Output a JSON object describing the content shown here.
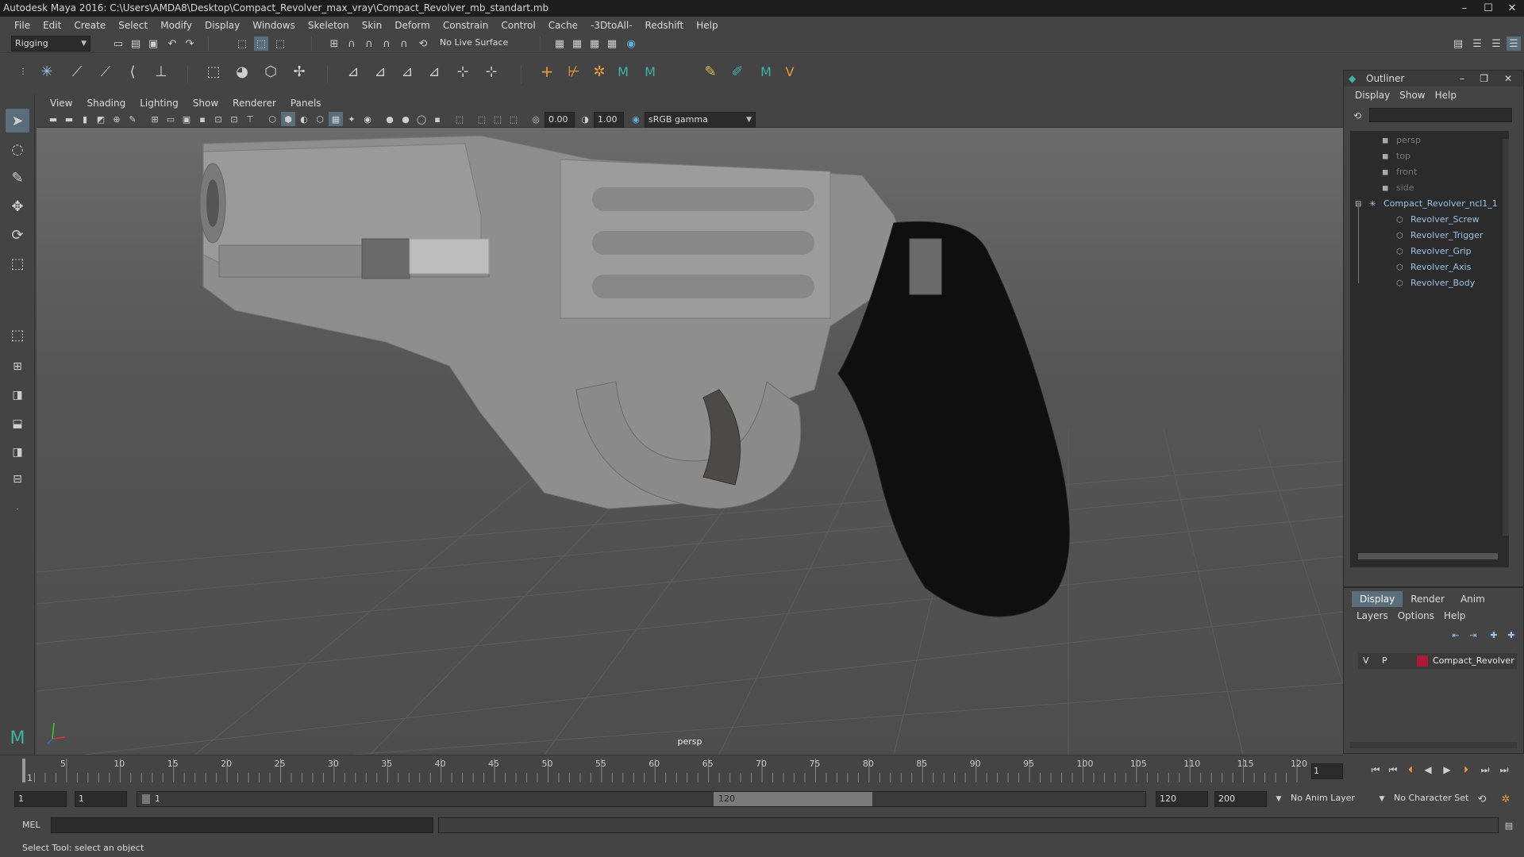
{
  "title": "Autodesk Maya 2016: C:\\Users\\AMDA8\\Desktop\\Compact_Revolver_max_vray\\Compact_Revolver_mb_standart.mb",
  "menu": [
    "File",
    "Edit",
    "Create",
    "Select",
    "Modify",
    "Display",
    "Windows",
    "Skeleton",
    "Skin",
    "Deform",
    "Constrain",
    "Control",
    "Cache",
    "-3DtoAll-",
    "Redshift",
    "Help"
  ],
  "shelf": {
    "mode": "Rigging",
    "live_surface": "No Live Surface"
  },
  "viewport": {
    "menu": [
      "View",
      "Shading",
      "Lighting",
      "Show",
      "Renderer",
      "Panels"
    ],
    "exposure": "0.00",
    "gamma": "1.00",
    "color_space": "sRGB gamma",
    "camera_label": "persp"
  },
  "timeline": {
    "ticks": [
      "1",
      "5",
      "10",
      "15",
      "20",
      "25",
      "30",
      "35",
      "40",
      "45",
      "50",
      "55",
      "60",
      "65",
      "70",
      "75",
      "80",
      "85",
      "90",
      "95",
      "100",
      "105",
      "110",
      "115",
      "120"
    ],
    "current_frame": "1"
  },
  "range": {
    "start": "1",
    "inner_start": "1",
    "slider_start": "1",
    "slider_end": "120",
    "end": "120",
    "anim_end": "200",
    "anim_layer": "No Anim Layer",
    "character_set": "No Character Set"
  },
  "mel": {
    "label": "MEL"
  },
  "help_line": "Select Tool: select an object",
  "outliner": {
    "title": "Outliner",
    "menu": [
      "Display",
      "Show",
      "Help"
    ],
    "cameras": [
      "persp",
      "top",
      "front",
      "side"
    ],
    "root": "Compact_Revolver_ncl1_1",
    "children": [
      "Revolver_Screw",
      "Revolver_Trigger",
      "Revolver_Grip",
      "Revolver_Axis",
      "Revolver_Body"
    ]
  },
  "layers": {
    "tabs": [
      "Display",
      "Render",
      "Anim"
    ],
    "menu": [
      "Layers",
      "Options",
      "Help"
    ],
    "row": {
      "v": "V",
      "p": "P",
      "name": "Compact_Revolver",
      "color": "#b0183a"
    }
  },
  "colors": {
    "accent": "#5a6d7a",
    "viewport_top": "#6b6b6b",
    "viewport_bottom": "#4d4d4d"
  }
}
